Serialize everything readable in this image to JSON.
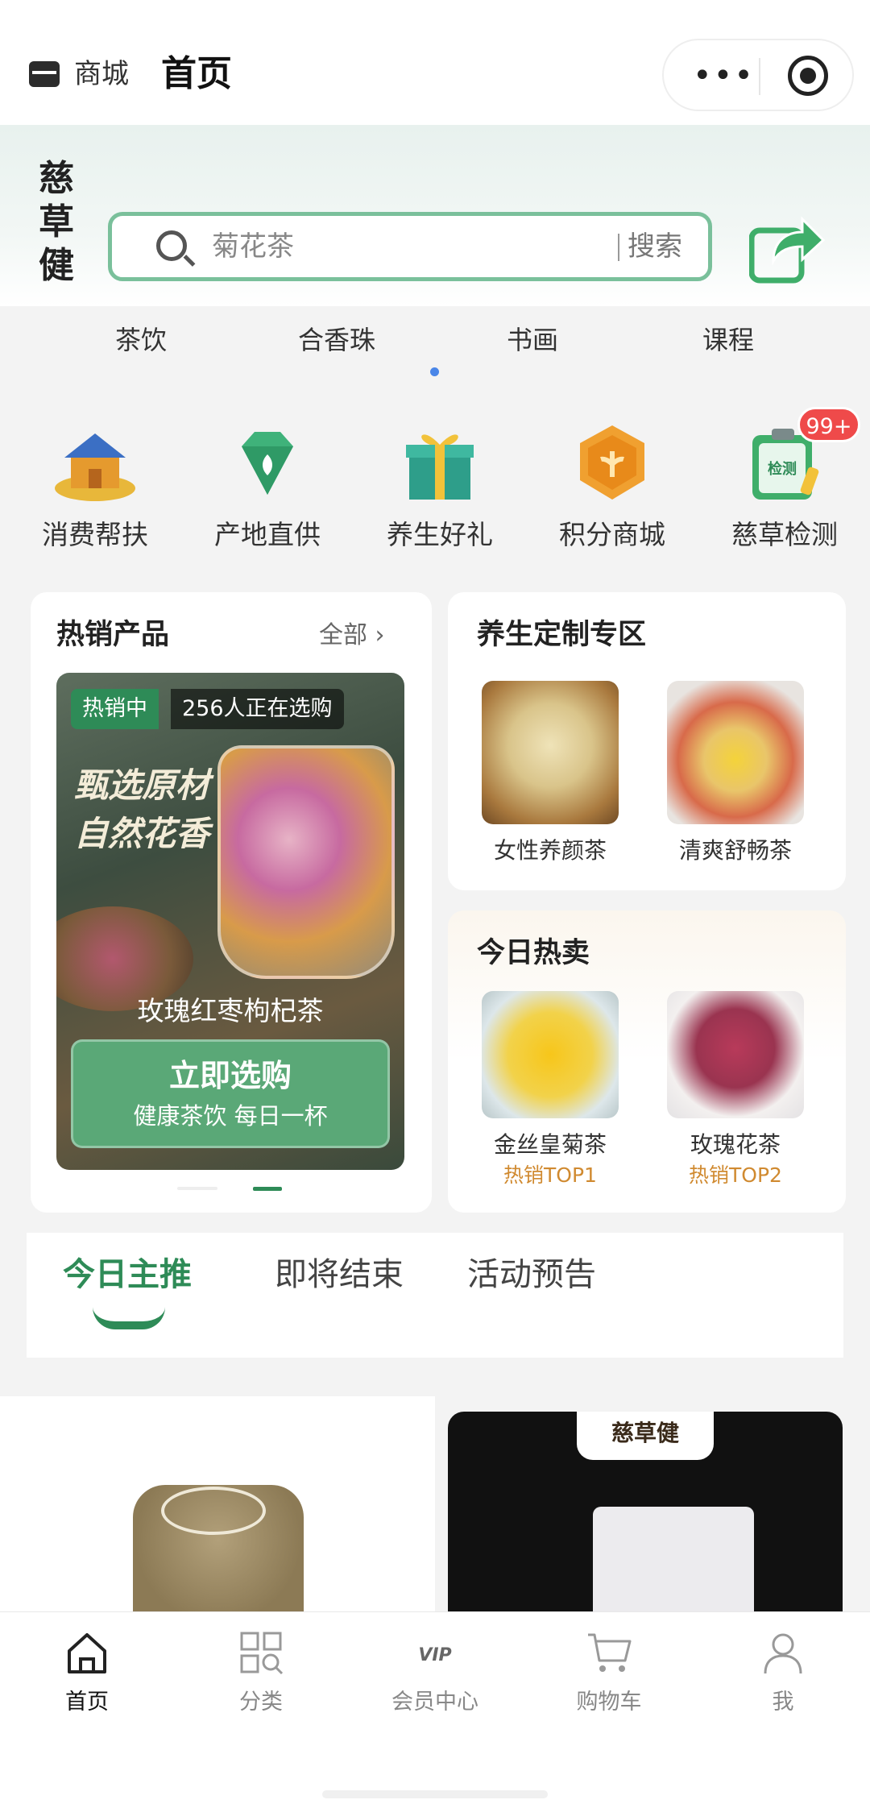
{
  "header": {
    "mall": "商城",
    "title": "首页"
  },
  "banner": {
    "logo": "慈草健",
    "search_placeholder": "菊花茶",
    "search_button": "搜索"
  },
  "categories": [
    "茶饮",
    "合香珠",
    "书画",
    "课程"
  ],
  "quick_icons": [
    {
      "label": "消费帮扶",
      "icon": "house-icon"
    },
    {
      "label": "产地直供",
      "icon": "diamond-icon"
    },
    {
      "label": "养生好礼",
      "icon": "gift-icon"
    },
    {
      "label": "积分商城",
      "icon": "points-icon"
    },
    {
      "label": "慈草检测",
      "icon": "test-kit-icon",
      "badge": "99+"
    }
  ],
  "hot_products": {
    "title": "热销产品",
    "all": "全部",
    "tag": "热销中",
    "viewers": "256人正在选购",
    "slogan_line1": "甄选原材",
    "slogan_line2": "自然花香",
    "product": "玫瑰红枣枸杞茶",
    "cta": "立即选购",
    "cta_sub": "健康茶饮  每日一杯"
  },
  "custom_zone": {
    "title": "养生定制专区",
    "items": [
      {
        "name": "女性养颜茶"
      },
      {
        "name": "清爽舒畅茶"
      }
    ]
  },
  "today_hot": {
    "title": "今日热卖",
    "items": [
      {
        "name": "金丝皇菊茶",
        "rank": "热销TOP1"
      },
      {
        "name": "玫瑰花茶",
        "rank": "热销TOP2"
      }
    ]
  },
  "sub_tabs": [
    "今日主推",
    "即将结束",
    "活动预告"
  ],
  "product_brand": "慈草健",
  "bottom_nav": [
    {
      "label": "首页",
      "icon": "home-icon"
    },
    {
      "label": "分类",
      "icon": "category-icon"
    },
    {
      "label": "会员中心",
      "icon": "vip-icon",
      "icon_text": "VIP"
    },
    {
      "label": "购物车",
      "icon": "cart-icon"
    },
    {
      "label": "我",
      "icon": "user-icon"
    }
  ],
  "colors": {
    "accent": "#2e8b57",
    "search_border": "#7ac09b",
    "badge": "#ef4a4a",
    "rank": "#d08a30"
  }
}
